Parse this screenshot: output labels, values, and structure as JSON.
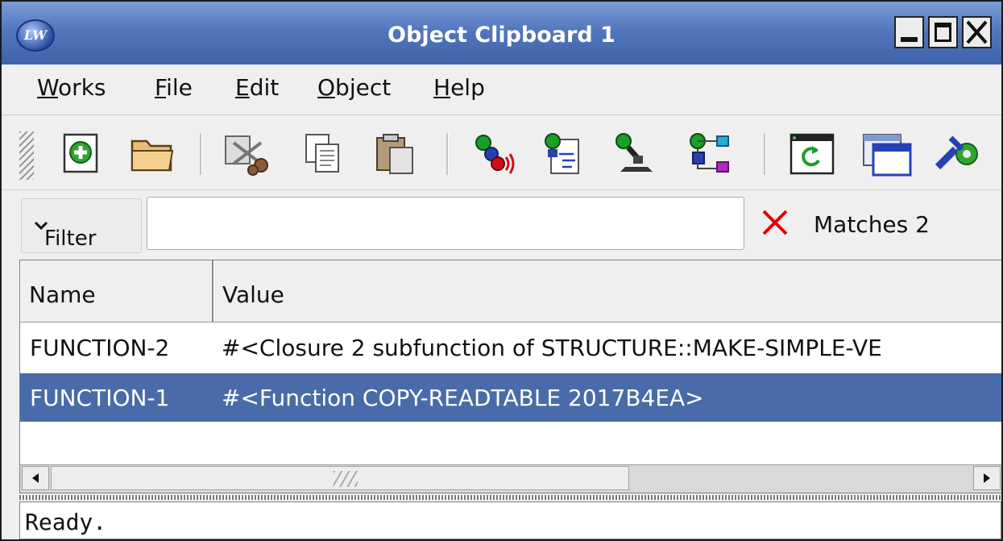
{
  "window": {
    "title": "Object Clipboard 1",
    "logo_text": "LW",
    "controls": [
      "minimize-icon",
      "maximize-icon",
      "close-icon"
    ]
  },
  "menubar": {
    "items": [
      {
        "label": "Works",
        "underline_char": "W"
      },
      {
        "label": "File",
        "underline_char": "F"
      },
      {
        "label": "Edit",
        "underline_char": "E"
      },
      {
        "label": "Object",
        "underline_char": "O"
      },
      {
        "label": "Help",
        "underline_char": "H"
      }
    ]
  },
  "toolbar": {
    "buttons": [
      "new-icon",
      "open-folder-icon",
      "cut-icon",
      "copy-icon",
      "paste-icon",
      "send-icon",
      "inspect-icon",
      "browse-icon",
      "structure-icon",
      "refresh-icon",
      "new-window-icon",
      "tools-icon"
    ]
  },
  "filter": {
    "label": "Filter",
    "value": "",
    "placeholder": "",
    "clear_icon": "clear-x-icon",
    "matches_text": "Matches 2"
  },
  "table": {
    "columns": [
      "Name",
      "Value"
    ],
    "rows": [
      {
        "name": "FUNCTION-2",
        "value": "#<Closure 2 subfunction of STRUCTURE::MAKE-SIMPLE-VE",
        "selected": false
      },
      {
        "name": "FUNCTION-1",
        "value": "#<Function COPY-READTABLE 2017B4EA>",
        "selected": true
      }
    ]
  },
  "status": {
    "text": "Ready."
  },
  "colors": {
    "titlebar": "#5277bd",
    "selection": "#4a6ba9",
    "clear_x": "#e30000"
  }
}
